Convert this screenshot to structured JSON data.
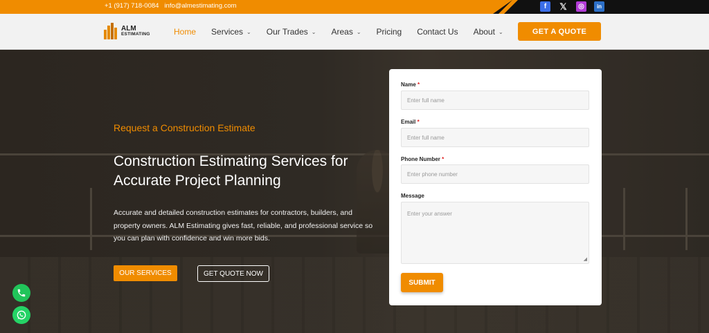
{
  "topbar": {
    "phone": "+1 (917) 718-0084",
    "email": "info@almestimating.com",
    "socials": [
      {
        "icon": "facebook-icon",
        "glyph": "f"
      },
      {
        "icon": "x-icon",
        "glyph": "𝕏"
      },
      {
        "icon": "instagram-icon",
        "glyph": "◎"
      },
      {
        "icon": "linkedin-icon",
        "glyph": "in"
      }
    ]
  },
  "header": {
    "logo_line1": "ALM",
    "logo_line2": "ESTIMATING",
    "nav": [
      {
        "label": "Home",
        "dropdown": false,
        "active": true
      },
      {
        "label": "Services",
        "dropdown": true
      },
      {
        "label": "Our Trades",
        "dropdown": true
      },
      {
        "label": "Areas",
        "dropdown": true
      },
      {
        "label": "Pricing",
        "dropdown": false
      },
      {
        "label": "Contact Us",
        "dropdown": false
      },
      {
        "label": "About",
        "dropdown": true
      }
    ],
    "cta": "GET A QUOTE"
  },
  "hero": {
    "eyebrow": "Request a Construction Estimate",
    "title": "Construction Estimating Services for Accurate Project Planning",
    "description": "Accurate and detailed construction estimates for contractors, builders, and property owners. ALM Estimating gives fast, reliable, and professional service so you can plan with confidence and win more bids.",
    "btn_services": "OUR SERVICES",
    "btn_quote": "GET QUOTE NOW"
  },
  "form": {
    "name_label": "Name",
    "name_placeholder": "Enter full name",
    "email_label": "Email",
    "email_placeholder": "Enter full name",
    "phone_label": "Phone Number",
    "phone_placeholder": "Enter phone number",
    "message_label": "Message",
    "message_placeholder": "Enter your answer",
    "required_mark": "*",
    "submit": "SUBMIT"
  },
  "colors": {
    "accent": "#f08c00",
    "topbar_dark": "#111111",
    "whatsapp": "#25d366"
  }
}
